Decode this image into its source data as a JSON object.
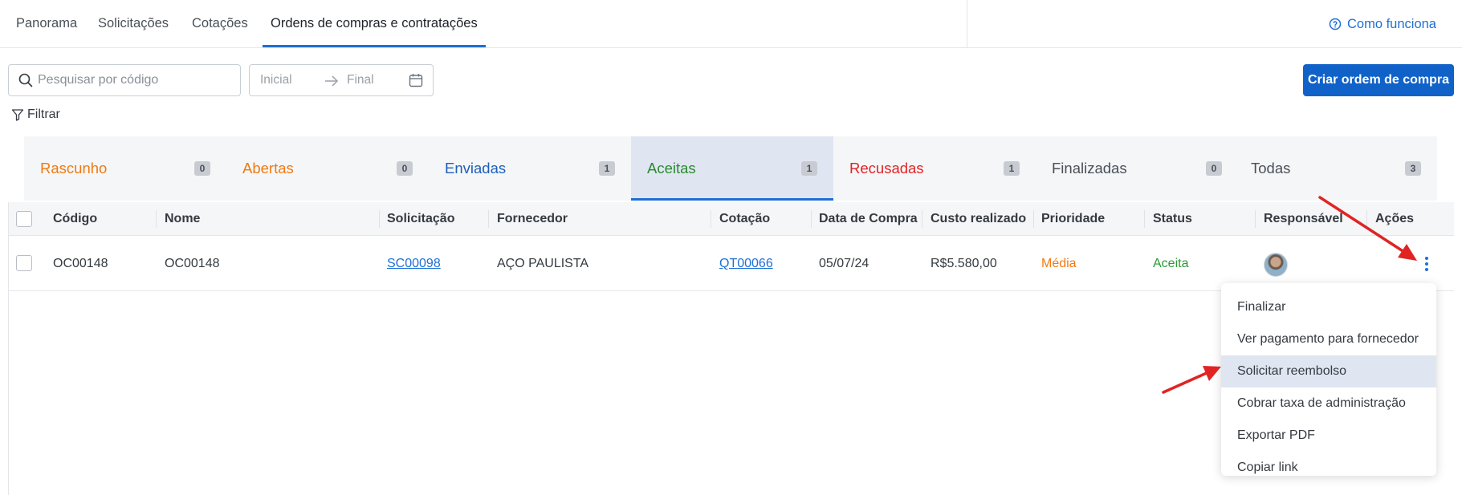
{
  "nav": {
    "tabs": [
      {
        "label": "Panorama"
      },
      {
        "label": "Solicitações"
      },
      {
        "label": "Cotações"
      },
      {
        "label": "Ordens de compras e contratações",
        "active": true
      }
    ],
    "help_label": "Como funciona",
    "help_icon": "question-circle-icon"
  },
  "toolbar": {
    "search_placeholder": "Pesquisar por código",
    "date_start_placeholder": "Inicial",
    "date_end_placeholder": "Final",
    "create_label": "Criar ordem de compra",
    "filter_label": "Filtrar"
  },
  "status_tabs": [
    {
      "label": "Rascunho",
      "count": "0",
      "color": "#ef7a12"
    },
    {
      "label": "Abertas",
      "count": "0",
      "color": "#ef7a12"
    },
    {
      "label": "Enviadas",
      "count": "1",
      "color": "#1d5fb8"
    },
    {
      "label": "Aceitas",
      "count": "1",
      "color": "#2a8a2e",
      "active": true
    },
    {
      "label": "Recusadas",
      "count": "1",
      "color": "#e02424"
    },
    {
      "label": "Finalizadas",
      "count": "0",
      "color": "#495057"
    },
    {
      "label": "Todas",
      "count": "3",
      "color": "#495057"
    }
  ],
  "table": {
    "columns": [
      "Código",
      "Nome",
      "Solicitação",
      "Fornecedor",
      "Cotação",
      "Data de Compra",
      "Custo realizado",
      "Prioridade",
      "Status",
      "Responsável",
      "Ações"
    ],
    "rows": [
      {
        "codigo": "OC00148",
        "nome": "OC00148",
        "solicitacao": "SC00098",
        "fornecedor": "AÇO PAULISTA",
        "cotacao": "QT00066",
        "data": "05/07/24",
        "custo": "R$5.580,00",
        "prioridade": "Média",
        "status": "Aceita"
      }
    ]
  },
  "actions_menu": {
    "items": [
      {
        "label": "Finalizar"
      },
      {
        "label": "Ver pagamento para fornecedor"
      },
      {
        "label": "Solicitar reembolso",
        "highlighted": true
      },
      {
        "label": "Cobrar taxa de administração"
      },
      {
        "label": "Exportar PDF"
      },
      {
        "label": "Copiar link"
      }
    ]
  },
  "colors": {
    "accent": "#1d6fd6",
    "button": "#1062c9",
    "annotation_arrow": "#e02424",
    "priority_medium": "#ef7a12",
    "status_accepted": "#2a9a35"
  }
}
